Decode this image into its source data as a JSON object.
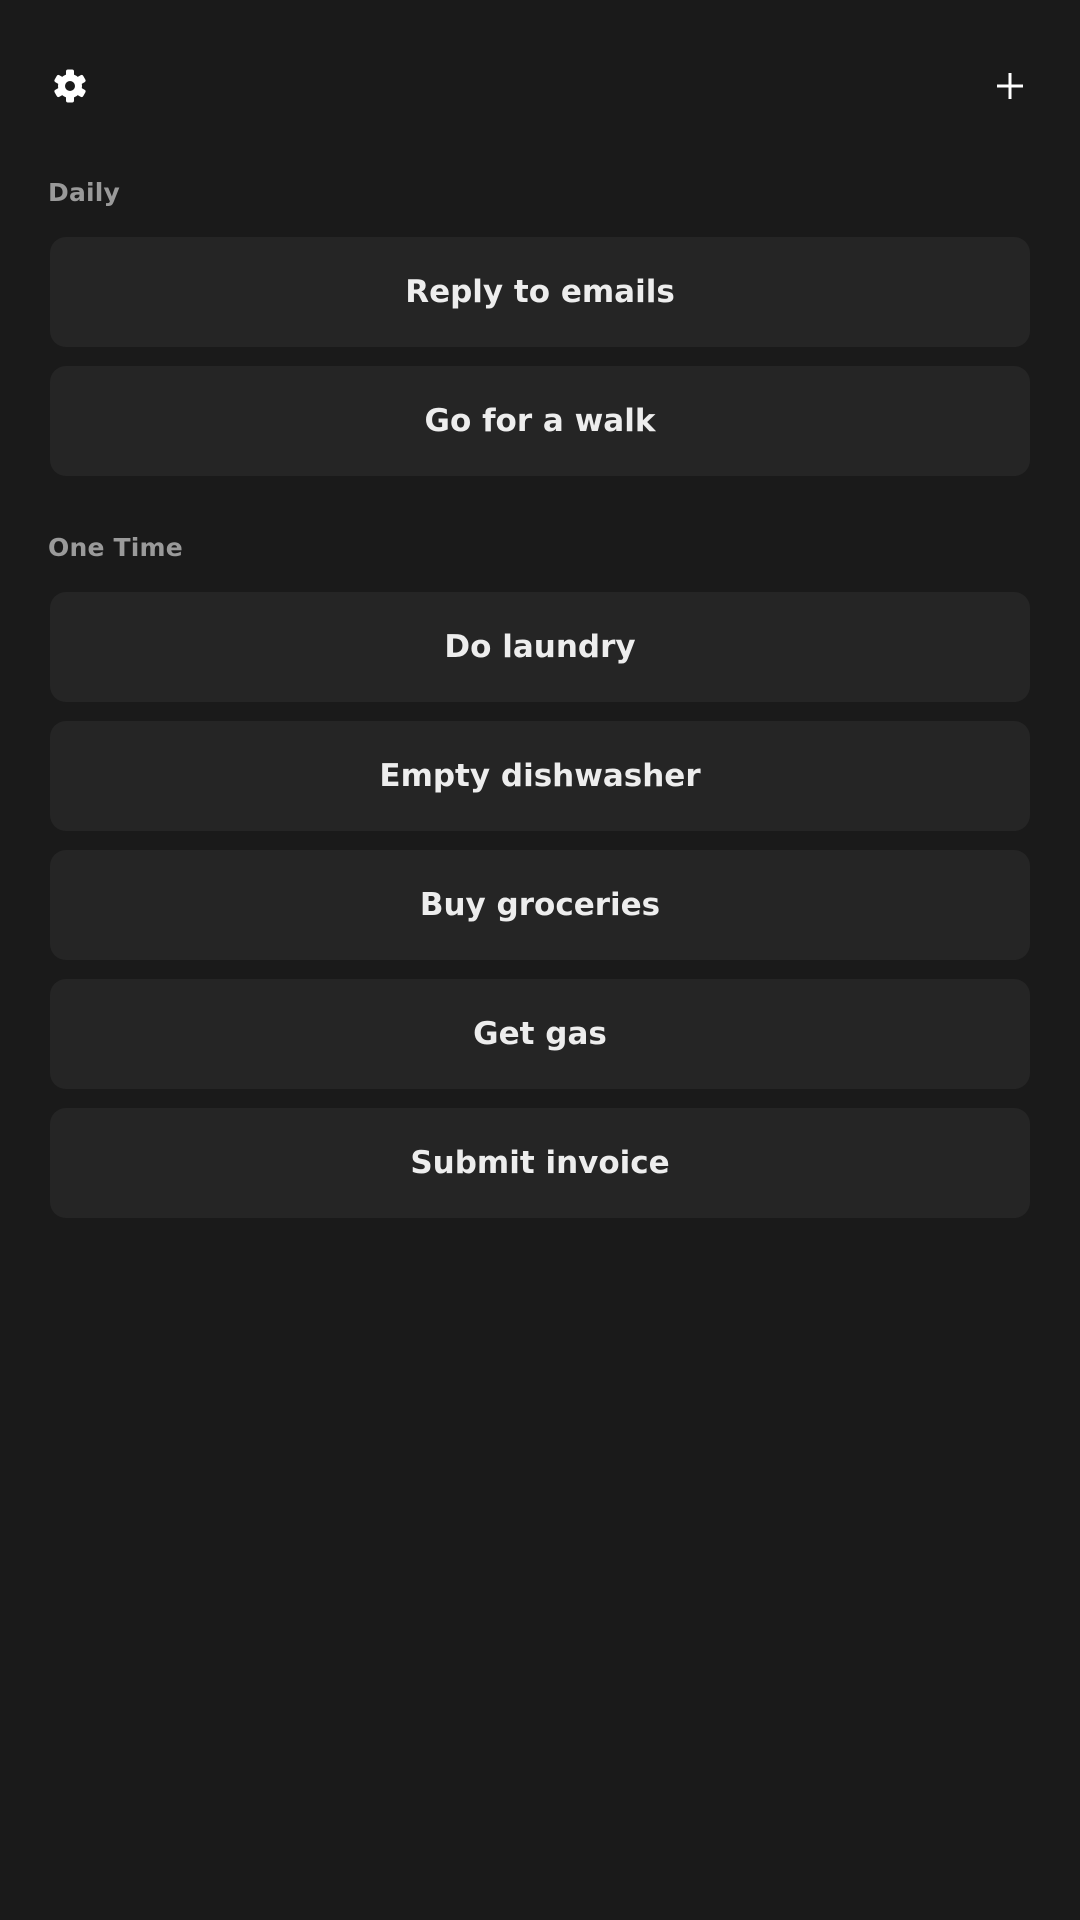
{
  "header": {
    "settings_icon": "gear-icon",
    "add_icon": "plus-icon"
  },
  "sections": [
    {
      "label": "Daily",
      "tasks": [
        "Reply to emails",
        "Go for a walk"
      ]
    },
    {
      "label": "One Time",
      "tasks": [
        "Do laundry",
        "Empty dishwasher",
        "Buy groceries",
        "Get gas",
        "Submit invoice"
      ]
    }
  ],
  "colors": {
    "background": "#1a1a1a",
    "card": "#252525",
    "text": "#ededed",
    "section_label": "#9a9a9a"
  }
}
